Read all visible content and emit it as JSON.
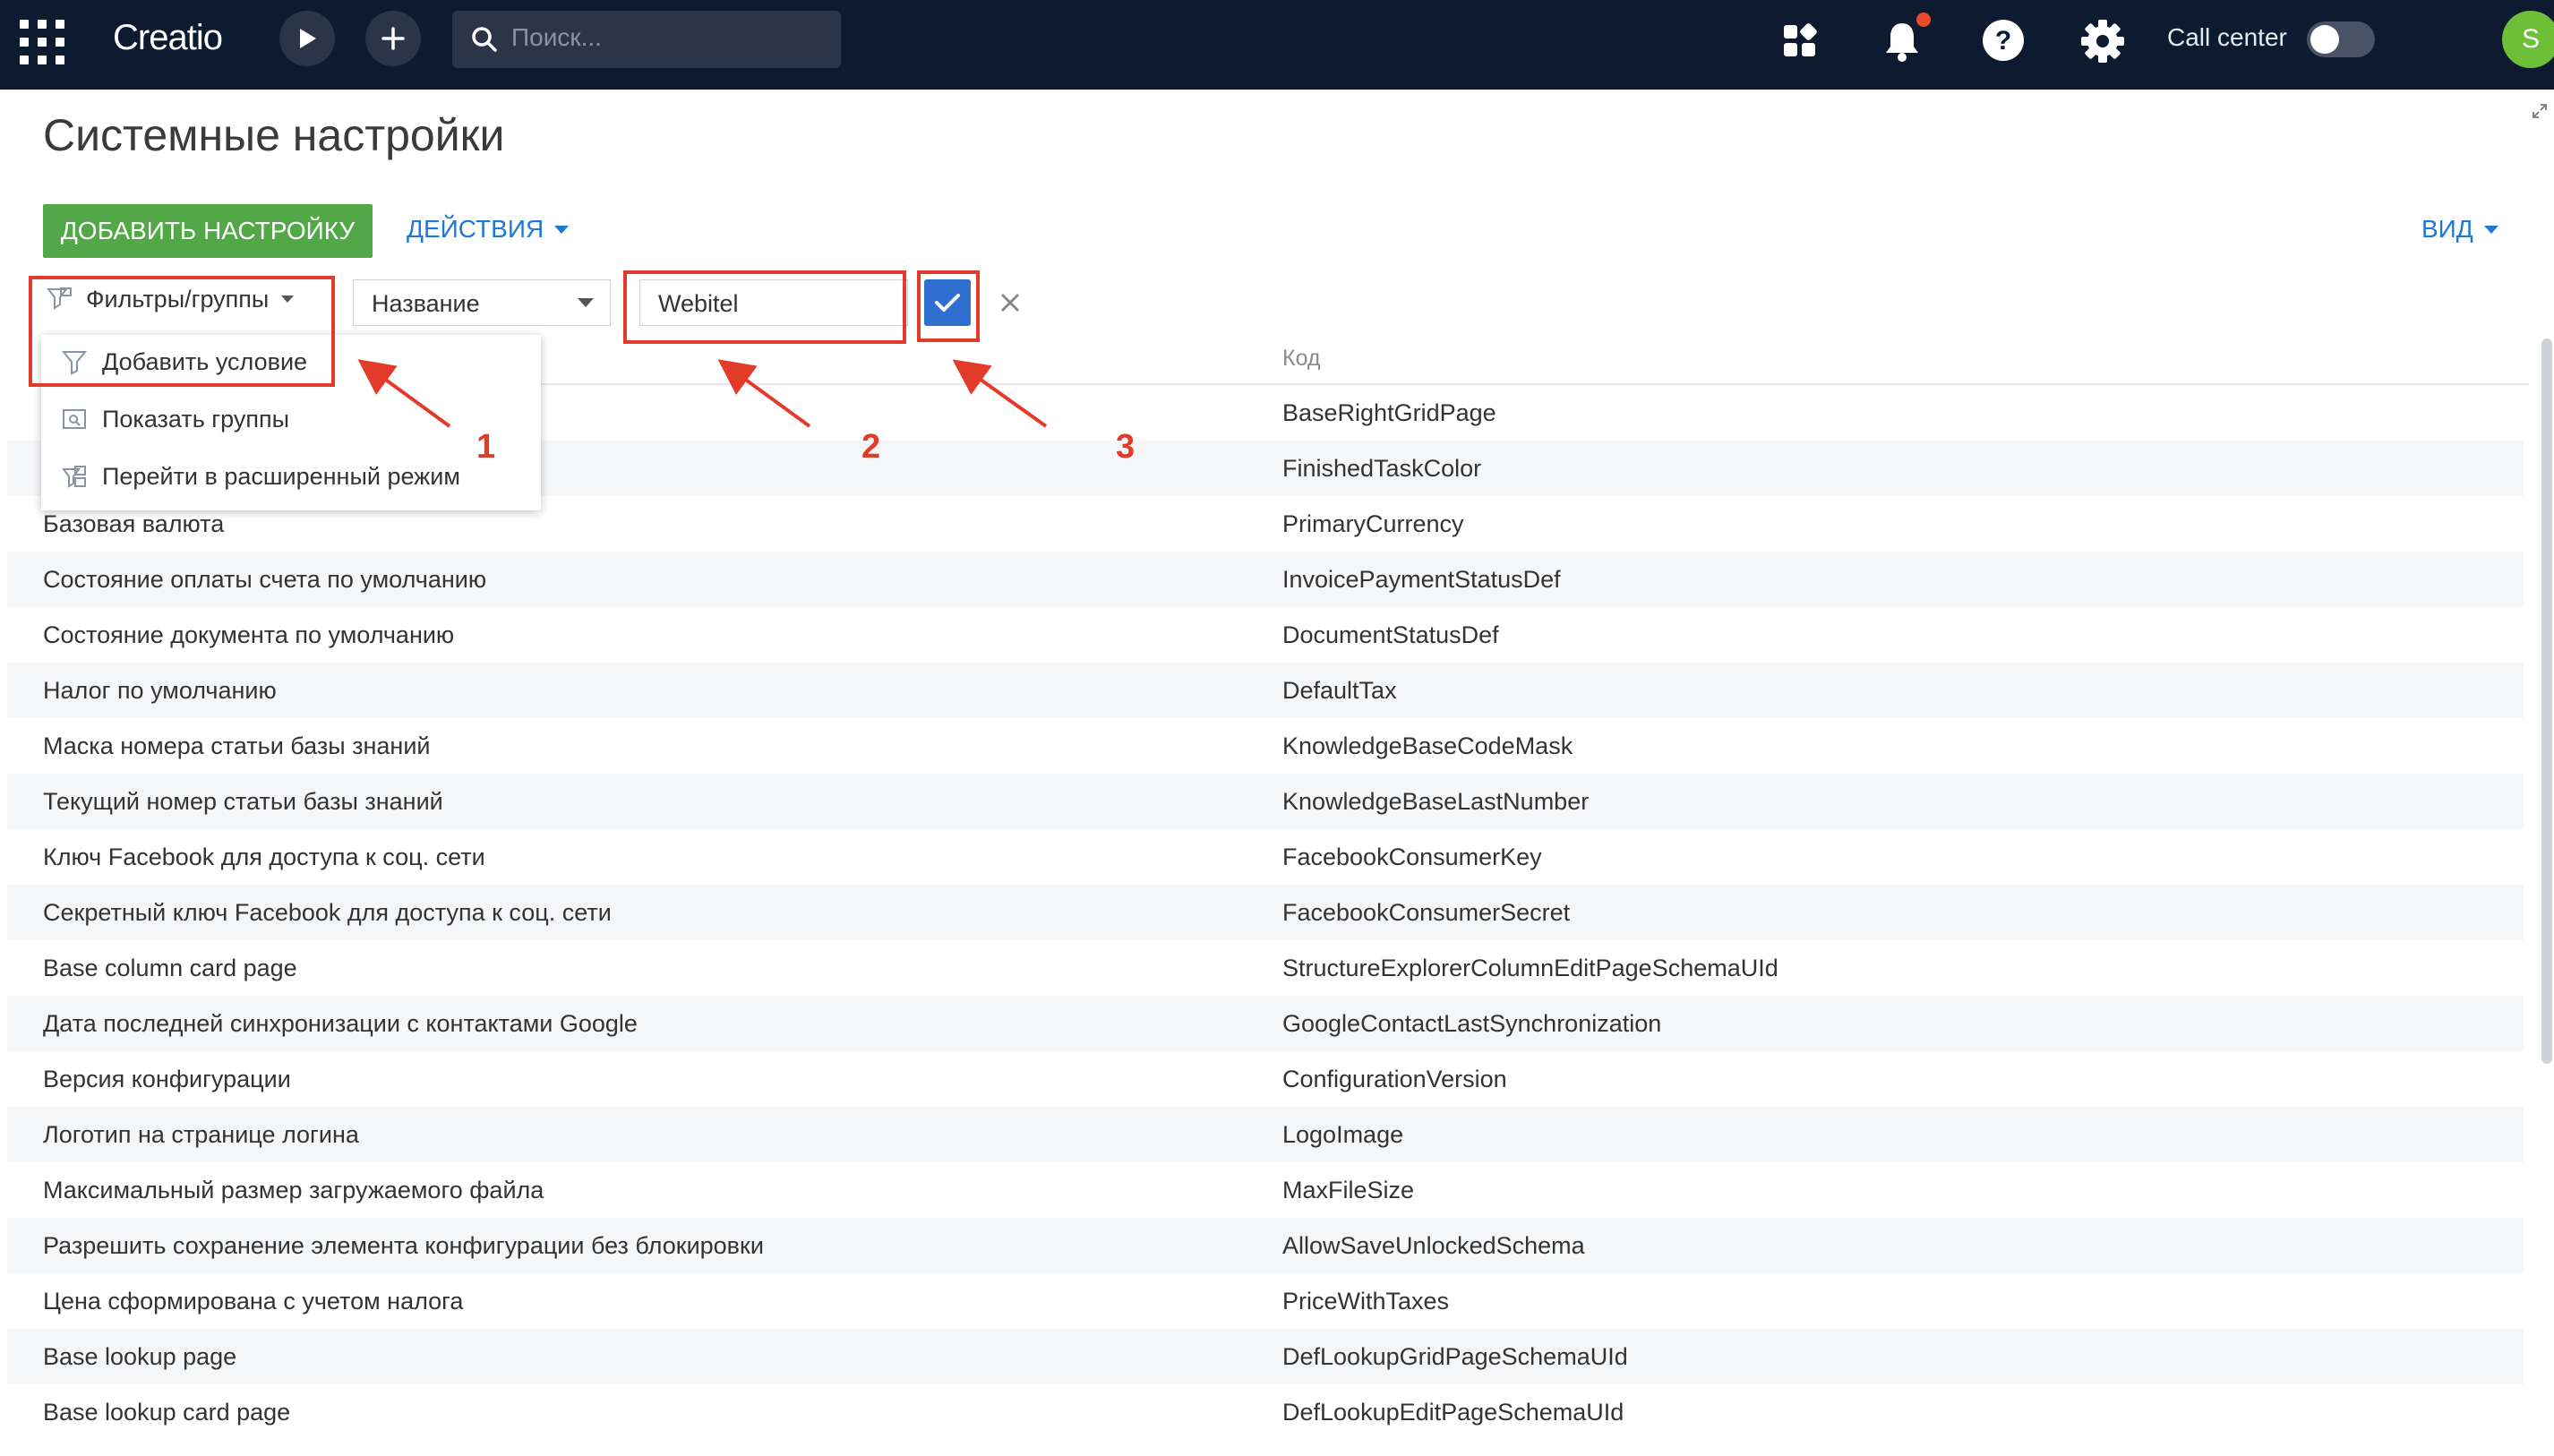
{
  "topbar": {
    "logo": "Creatio",
    "search_placeholder": "Поиск...",
    "call_center_label": "Call center",
    "avatar_letter": "S",
    "colors": {
      "bar": "#0e1a30",
      "notification_dot": "#e84a2b",
      "avatar": "#6cbf36"
    }
  },
  "page": {
    "title": "Системные настройки",
    "add_button": "ДОБАВИТЬ НАСТРОЙКУ",
    "actions_button": "ДЕЙСТВИЯ",
    "view_button": "ВИД"
  },
  "filter": {
    "filters_label": "Фильтры/группы",
    "column_select_value": "Название",
    "search_value": "Webitel"
  },
  "dropdown": {
    "items": [
      {
        "label": "Добавить условие",
        "icon": "filter-icon"
      },
      {
        "label": "Показать группы",
        "icon": "folder-icon"
      },
      {
        "label": "Перейти в расширенный режим",
        "icon": "advanced-filter-icon"
      }
    ]
  },
  "grid": {
    "code_header": "Код",
    "rows": [
      {
        "name": "",
        "code": "BaseRightGridPage"
      },
      {
        "name": "",
        "code": "FinishedTaskColor"
      },
      {
        "name": "Базовая валюта",
        "code": "PrimaryCurrency"
      },
      {
        "name": "Состояние оплаты счета по умолчанию",
        "code": "InvoicePaymentStatusDef"
      },
      {
        "name": "Состояние документа по умолчанию",
        "code": "DocumentStatusDef"
      },
      {
        "name": "Налог по умолчанию",
        "code": "DefaultTax"
      },
      {
        "name": "Маска номера статьи базы знаний",
        "code": "KnowledgeBaseCodeMask"
      },
      {
        "name": "Текущий номер статьи базы знаний",
        "code": "KnowledgeBaseLastNumber"
      },
      {
        "name": "Ключ Facebook для доступа к соц. сети",
        "code": "FacebookConsumerKey"
      },
      {
        "name": "Секретный ключ Facebook для доступа к соц. сети",
        "code": "FacebookConsumerSecret"
      },
      {
        "name": "Base column card page",
        "code": "StructureExplorerColumnEditPageSchemaUId"
      },
      {
        "name": "Дата последней синхронизации с контактами Google",
        "code": "GoogleContactLastSynchronization"
      },
      {
        "name": "Версия конфигурации",
        "code": "ConfigurationVersion"
      },
      {
        "name": "Логотип на странице логина",
        "code": "LogoImage"
      },
      {
        "name": "Максимальный размер загружаемого файла",
        "code": "MaxFileSize"
      },
      {
        "name": "Разрешить сохранение элемента конфигурации без блокировки",
        "code": "AllowSaveUnlockedSchema"
      },
      {
        "name": "Цена сформирована с учетом налога",
        "code": "PriceWithTaxes"
      },
      {
        "name": "Base lookup page",
        "code": "DefLookupGridPageSchemaUId"
      },
      {
        "name": "Base lookup card page",
        "code": "DefLookupEditPageSchemaUId"
      }
    ]
  },
  "annotations": {
    "n1": "1",
    "n2": "2",
    "n3": "3",
    "color": "#e23b2a"
  }
}
